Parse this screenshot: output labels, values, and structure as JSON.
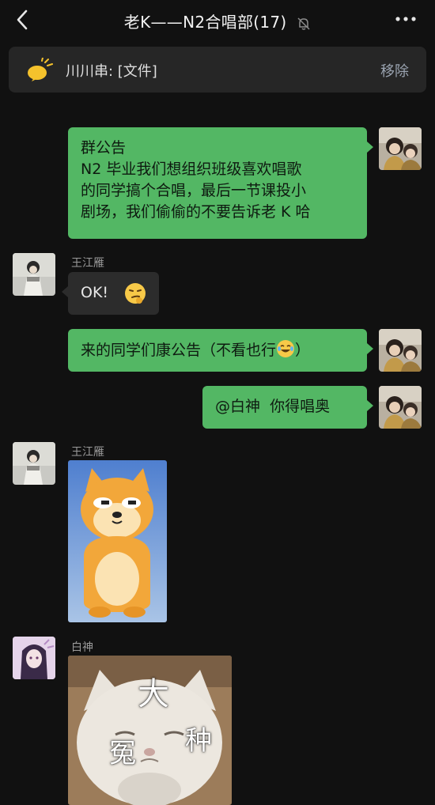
{
  "header": {
    "title": "老K——N2合唱部(17)",
    "back_icon": "chevron-left-icon",
    "mute_icon": "bell-off-icon",
    "more_icon": "more-dots-icon"
  },
  "pinned": {
    "text": "川川串: [文件]",
    "action": "移除",
    "icon": "megaphone-icon"
  },
  "messages": [
    {
      "side": "me",
      "lines": [
        "群公告",
        "N2 毕业我们想组织班级喜欢唱歌",
        "的同学搞个合唱，最后一节课投小",
        "剧场，我们偷偷的不要告诉老 K 哈"
      ]
    },
    {
      "side": "other",
      "sender": "王江雁",
      "text": "OK!",
      "emoji": "smirk-emoji"
    },
    {
      "side": "me",
      "text": "来的同学们康公告（不看也行",
      "emoji_end": "laughing-crying-emoji",
      "suffix": "）"
    },
    {
      "side": "me",
      "text": "@白神  你得唱奥"
    },
    {
      "side": "other",
      "sender": "王江雁",
      "sticker": "shiba-doge-3d-sticker"
    },
    {
      "side": "other",
      "sender": "白神",
      "sticker": "sad-cat-sticker",
      "sticker_chars": [
        "大",
        "冤",
        "种"
      ]
    }
  ],
  "colors": {
    "background": "#111111",
    "my_bubble": "#53b764",
    "other_bubble": "#2c2c2c"
  }
}
